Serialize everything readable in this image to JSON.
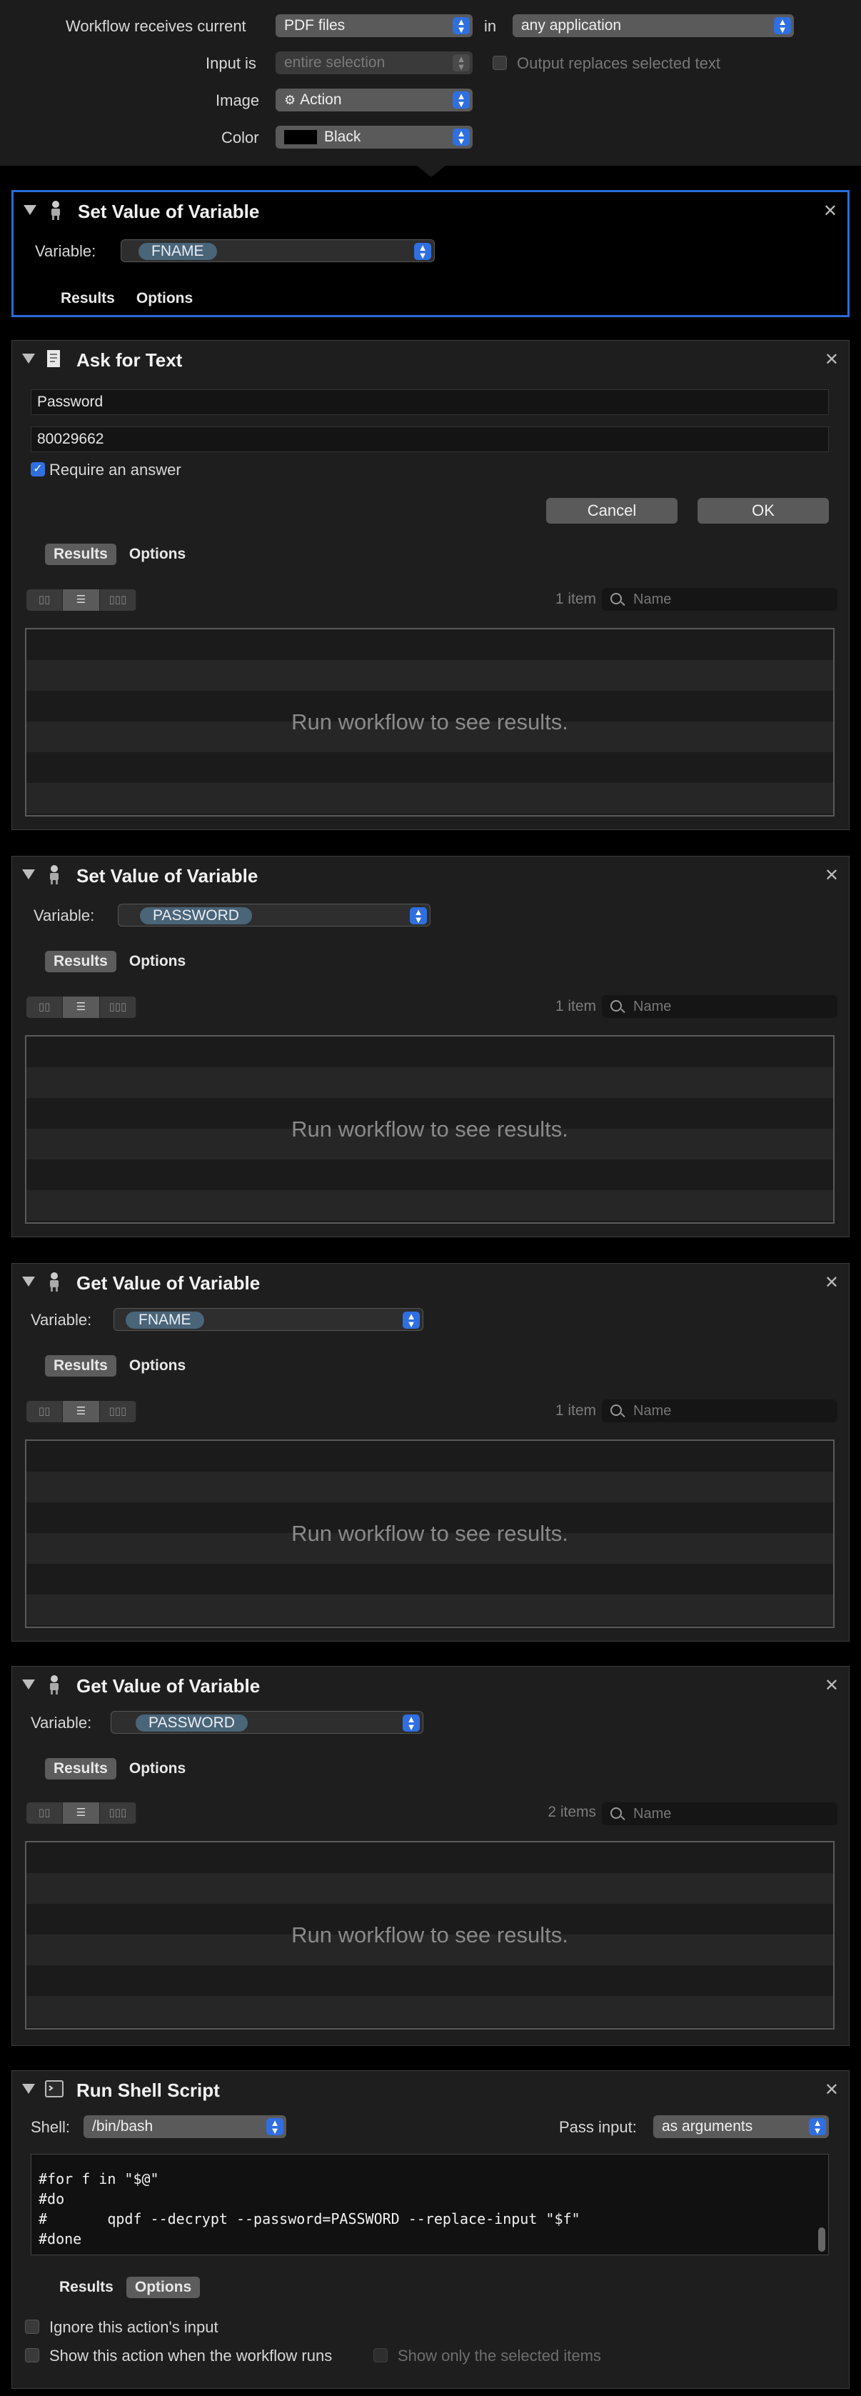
{
  "header": {
    "receives_label": "Workflow receives current",
    "receives_value": "PDF files",
    "in_label": "in",
    "app_value": "any application",
    "input_is_label": "Input is",
    "input_is_value": "entire selection",
    "output_replaces_label": "Output replaces selected text",
    "image_label": "Image",
    "image_value": "Action",
    "color_label": "Color",
    "color_value": "Black"
  },
  "actions": [
    {
      "title": "Set Value of Variable",
      "variable_label": "Variable:",
      "variable": "FNAME",
      "tabs": [
        "Results",
        "Options"
      ],
      "active_tab": "none"
    },
    {
      "title": "Ask for Text",
      "question": "Password",
      "default_answer": "80029662",
      "require_answer_label": "Require an answer",
      "require_answer": true,
      "cancel_label": "Cancel",
      "ok_label": "OK",
      "tabs": [
        "Results",
        "Options"
      ],
      "active_tab": "Results",
      "count": "1 item",
      "search_placeholder": "Name",
      "results_message": "Run workflow to see results."
    },
    {
      "title": "Set Value of Variable",
      "variable_label": "Variable:",
      "variable": "PASSWORD",
      "tabs": [
        "Results",
        "Options"
      ],
      "active_tab": "Results",
      "count": "1 item",
      "search_placeholder": "Name",
      "results_message": "Run workflow to see results."
    },
    {
      "title": "Get Value of Variable",
      "variable_label": "Variable:",
      "variable": "FNAME",
      "tabs": [
        "Results",
        "Options"
      ],
      "active_tab": "Results",
      "count": "1 item",
      "search_placeholder": "Name",
      "results_message": "Run workflow to see results."
    },
    {
      "title": "Get Value of Variable",
      "variable_label": "Variable:",
      "variable": "PASSWORD",
      "tabs": [
        "Results",
        "Options"
      ],
      "active_tab": "Results",
      "count": "2 items",
      "search_placeholder": "Name",
      "results_message": "Run workflow to see results."
    },
    {
      "title": "Run Shell Script",
      "shell_label": "Shell:",
      "shell": "/bin/bash",
      "pass_input_label": "Pass input:",
      "pass_input": "as arguments",
      "code_lines": [
        "#for f in \"$@\"",
        "#do",
        "#       qpdf --decrypt --password=PASSWORD --replace-input \"$f\"",
        "#done"
      ],
      "tabs": [
        "Results",
        "Options"
      ],
      "active_tab": "Options",
      "ignore_input_label": "Ignore this action's input",
      "show_action_label": "Show this action when the workflow runs",
      "show_selected_label": "Show only the selected items"
    }
  ],
  "colors": {
    "accent": "#2f6fe0",
    "selected_border": "#2a6cd8",
    "panel": "#1e1e1e"
  }
}
